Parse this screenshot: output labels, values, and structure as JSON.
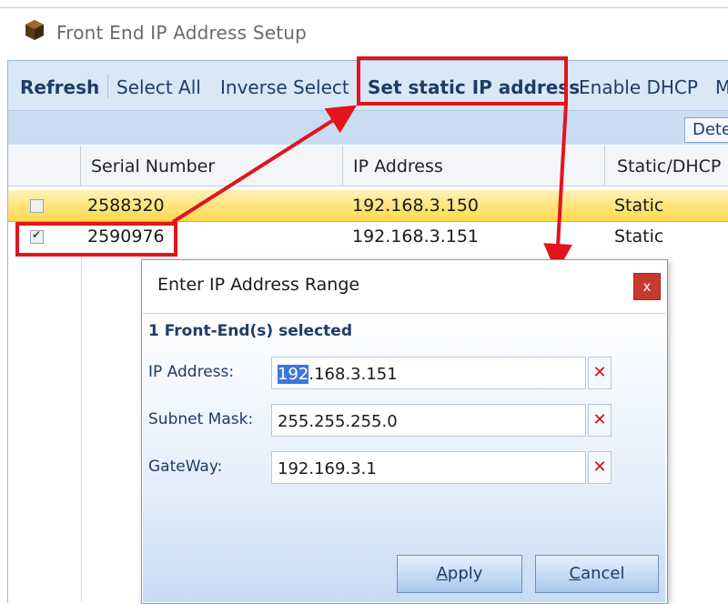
{
  "window": {
    "title": "Front End IP Address Setup",
    "icon": "cube-icon"
  },
  "toolbar": {
    "refresh": "Refresh",
    "select_all": "Select All",
    "inverse_select": "Inverse Select",
    "set_static": "Set static IP address",
    "enable_dhcp": "Enable DHCP",
    "more": "M",
    "detect": "Dete"
  },
  "grid": {
    "columns": [
      "Serial Number",
      "IP Address",
      "Static/DHCP"
    ],
    "rows": [
      {
        "checked": false,
        "serial": "2588320",
        "ip": "192.168.3.150",
        "mode": "Static"
      },
      {
        "checked": true,
        "serial": "2590976",
        "ip": "192.168.3.151",
        "mode": "Static"
      }
    ]
  },
  "dialog": {
    "title": "Enter IP Address Range",
    "close": "x",
    "selected": "1 Front-End(s) selected",
    "ip_label": "IP Address:",
    "ip_selected_part": "192",
    "ip_rest": ".168.3.151",
    "subnet_label": "Subnet Mask:",
    "subnet_value": "255.255.255.0",
    "gateway_label": "GateWay:",
    "gateway_value": "192.169.3.1",
    "clear_glyph": "✕",
    "apply_hotkey": "A",
    "apply_rest": "pply",
    "cancel_hotkey": "C",
    "cancel_rest": "ancel"
  },
  "colors": {
    "annotation": "#e3141b",
    "row_selected": "#ffd94a",
    "toolbar": "#d9e7f7"
  }
}
